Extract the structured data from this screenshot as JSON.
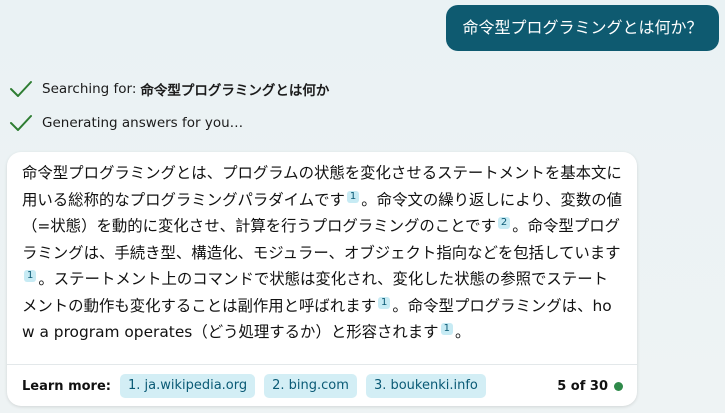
{
  "user_message": "命令型プログラミングとは何か？",
  "status": {
    "searching_label": "Searching for:",
    "searching_query": "命令型プログラミングとは何か",
    "generating": "Generating answers for you…"
  },
  "answer": {
    "seg1": "命令型プログラミングとは、プログラムの状態を変化させるステートメントを基本文に用いる総称的なプログラミングパラダイムです",
    "cite1": "1",
    "seg2": "。命令文の繰り返しにより、変数の値（=状態）を動的に変化させ、計算を行うプログラミングのことです",
    "cite2": "2",
    "seg3": "。命令型プログラミングは、手続き型、構造化、モジュラー、オブジェクト指向などを包括しています",
    "cite3": "1",
    "seg4": "。ステートメント上のコマンドで状態は変化され、変化した状態の参照でステートメントの動作も変化することは副作用と呼ばれます",
    "cite4": "1",
    "seg5": "。命令型プログラミングは、how a program operates（どう処理するか）と形容されます",
    "cite5": "1",
    "seg6": "。"
  },
  "learn_more": {
    "label": "Learn more:",
    "links": [
      "1. ja.wikipedia.org",
      "2. bing.com",
      "3. boukenki.info"
    ],
    "count": "5 of 30",
    "status_color": "#2f8a4a"
  }
}
